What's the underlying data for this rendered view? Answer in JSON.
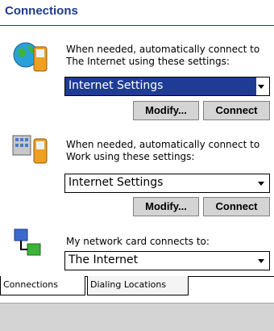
{
  "window": {
    "title": "Connections"
  },
  "internet": {
    "icon": "globe-phone-icon",
    "description": "When needed, automatically connect to The Internet using these settings:",
    "dropdown_value": "Internet Settings",
    "modify_label": "Modify...",
    "connect_label": "Connect"
  },
  "work": {
    "icon": "office-phone-icon",
    "description": "When needed, automatically connect to Work using these settings:",
    "dropdown_value": "Internet Settings",
    "modify_label": "Modify...",
    "connect_label": "Connect"
  },
  "network_card": {
    "icon": "network-card-icon",
    "description": "My network card connects to:",
    "dropdown_value": "The Internet"
  },
  "tabs": [
    {
      "label": "Connections",
      "active": true
    },
    {
      "label": "Dialing Locations",
      "active": false
    }
  ],
  "colors": {
    "title": "#1e3c8c",
    "selected_bg": "#1e3c96",
    "button_bg": "#d4d4d4"
  }
}
